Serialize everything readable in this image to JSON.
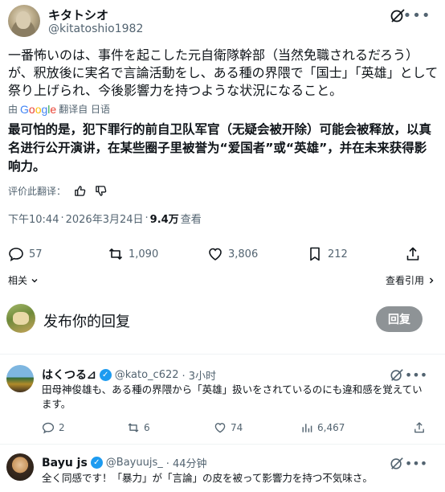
{
  "tweet": {
    "author_name": "キタトシオ",
    "author_handle": "@kitatoshio1982",
    "original_text": "一番怖いのは、事件を起こした元自衛隊幹部（当然免職されるだろう）が、釈放後に実名で言論活動をし、ある種の界隈で「国士」「英雄」として祭り上げられ、今後影響力を持つような状況になること。",
    "translated_by_prefix": "由",
    "translated_by_suffix": "翻译自 日语",
    "translation_text": "最可怕的是，犯下罪行的前自卫队军官（无疑会被开除）可能会被释放，以真名进行公开演讲，在某些圈子里被誉为“爱国者”或“英雄”，并在未来获得影响力。",
    "rate_label": "评价此翻译：",
    "time": "下午10:44",
    "date": "2026年3月24日",
    "views": "9.4万",
    "views_label": "查看",
    "stats": {
      "replies": "57",
      "retweets": "1,090",
      "likes": "3,806",
      "bookmarks": "212"
    },
    "related_label": "相关",
    "view_quotes_label": "查看引用"
  },
  "compose": {
    "placeholder": "发布你的回复",
    "reply_button": "回复"
  },
  "replies": [
    {
      "name": "はくつる⊿",
      "handle": "@kato_c622",
      "time": "· 3小时",
      "text": "田母神俊雄も、ある種の界隈から「英雄」扱いをされているのにも違和感を覚えています。",
      "stats": {
        "replies": "2",
        "retweets": "6",
        "likes": "74",
        "views": "6,467"
      }
    },
    {
      "name": "Bayu js",
      "handle": "@Bayuujs_",
      "time": "· 44分钟",
      "text": "全く同感です！「暴力」が「言論」の皮を被って影響力を持つ不気味さ。"
    }
  ],
  "colors": {
    "text": "#0f1419",
    "muted": "#536471",
    "verified": "#1d9bf0",
    "reply_button": "#8e9396"
  }
}
